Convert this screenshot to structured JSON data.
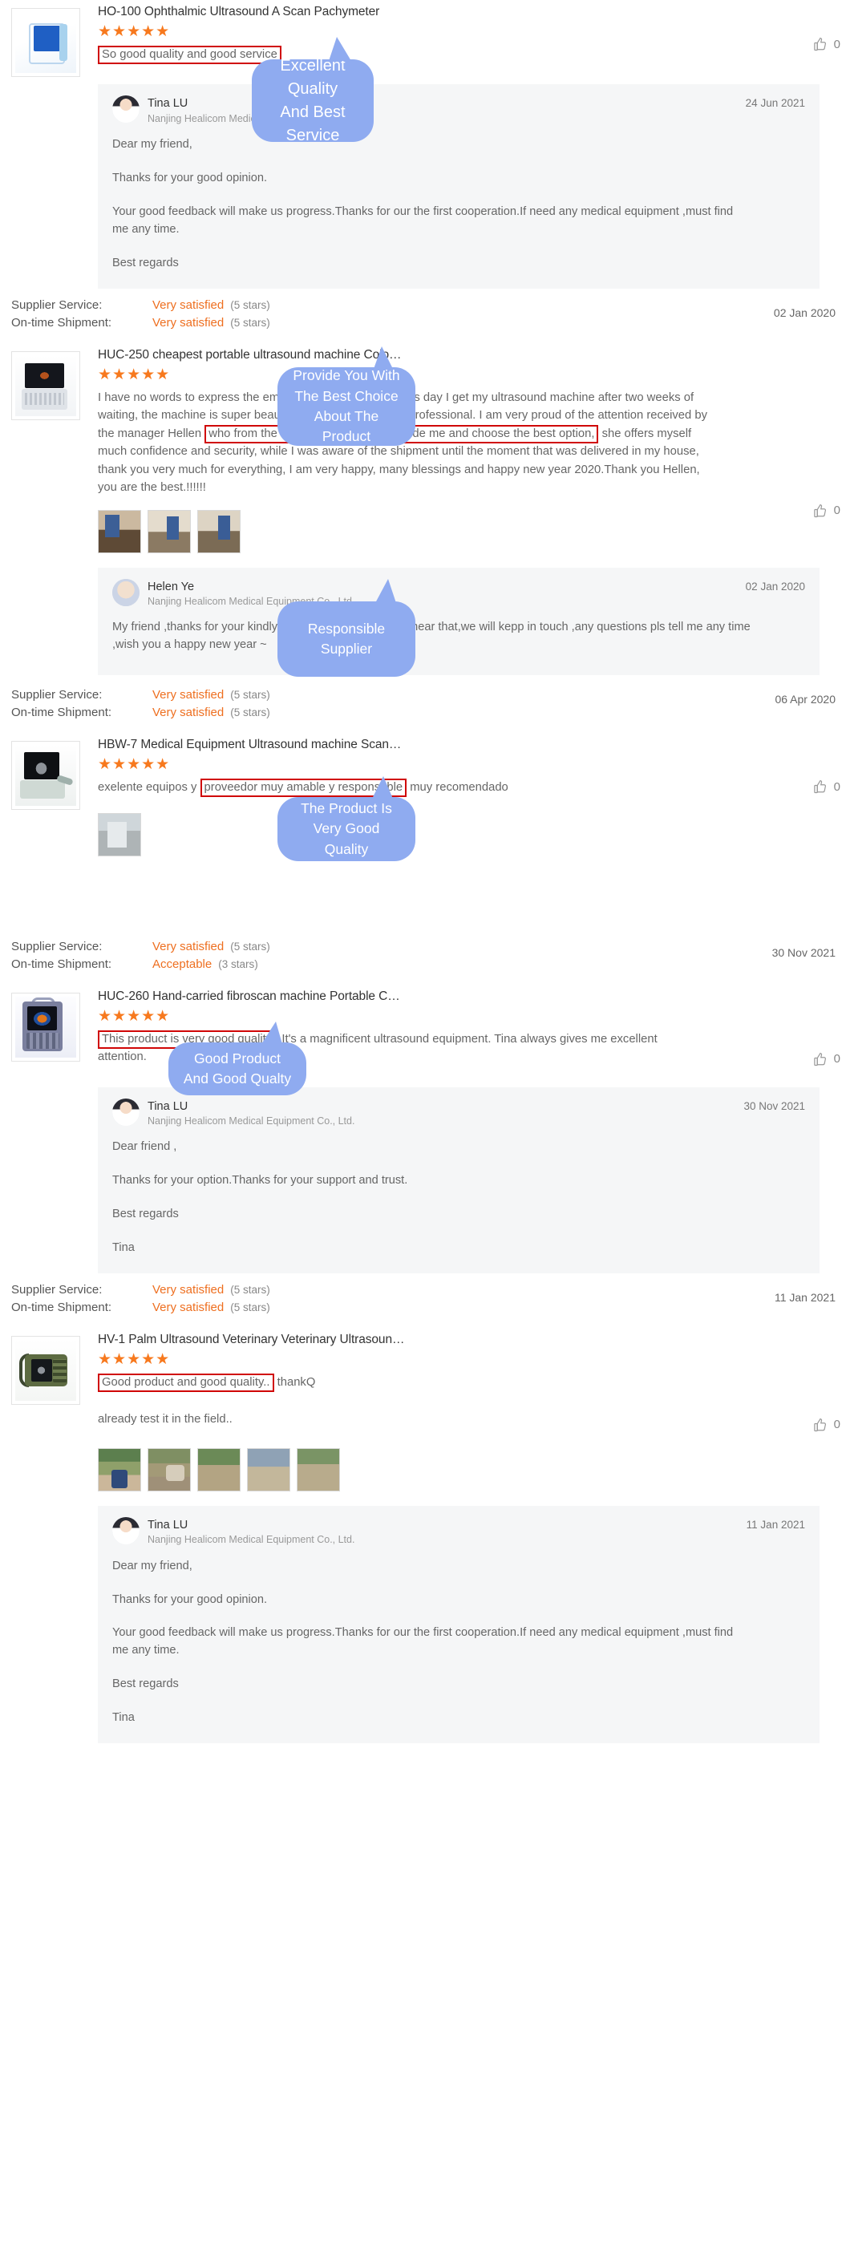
{
  "labels": {
    "supplier_service": "Supplier Service:",
    "on_time_shipment": "On-time Shipment:",
    "like_count": "0"
  },
  "reviews": [
    {
      "id": "ho-100",
      "product_title": "HO-100 Ophthalmic Ultrasound A Scan Pachymeter",
      "stars": "★★★★★",
      "review_text_highlight": "So good quality and good service",
      "like_count": "0",
      "reply": {
        "name": "Tina LU",
        "company": "Nanjing Healicom Medical Equipment Co., Ltd.",
        "date": "24 Jun 2021",
        "paragraphs": [
          "Dear my friend,",
          "Thanks for your good opinion.",
          "Your good feedback will make us progress.Thanks for our the first cooperation.If need any medical equipment ,must find me any time.",
          "Best regards"
        ]
      },
      "ratings": {
        "supplier_service_value": "Very satisfied",
        "supplier_service_stars": "(5 stars)",
        "on_time_value": "Very satisfied",
        "on_time_stars": "(5 stars)",
        "date": "02 Jan 2020"
      },
      "callout": "Excellent Quality\nAnd Best Service"
    },
    {
      "id": "huc-250",
      "product_title": "HUC-250 cheapest portable ultrasound machine Colo…",
      "stars": "★★★★★",
      "review_text_parts": [
        "I have no words to express the emotion that I have, in today's day I get my ultrasound machine after two weeks of waiting, the machine is super beautiful, all very secure and professional. I am very proud of the attention received by the manager Hellen",
        " who from the very first was there to guide me and choose the best option,",
        "she offers myself much confidence and security, while I was aware of the shipment until the moment that was delivered in my house, thank you very much for everything, I am very happy, many blessings and happy new year 2020.Thank you Hellen, you are the best.!!!!!!"
      ],
      "thumbnails": [
        "photo-box-1",
        "photo-box-2",
        "photo-box-3"
      ],
      "like_count": "0",
      "reply": {
        "name": "Helen Ye",
        "company": "Nanjing Healicom Medical Equipment Co., Ltd.",
        "date": "02 Jan 2020",
        "paragraphs": [
          "My friend ,thanks for your kindly comments,very happy to hear that,we will kepp in touch ,any questions pls tell me any time ,wish you a happy new year ~"
        ]
      },
      "ratings": {
        "supplier_service_value": "Very satisfied",
        "supplier_service_stars": "(5 stars)",
        "on_time_value": "Very satisfied",
        "on_time_stars": "(5 stars)",
        "date": "06 Apr 2020"
      },
      "callout": "Provide You With\nThe Best Choice\nAbout The Product"
    },
    {
      "id": "hbw-7",
      "product_title": "HBW-7 Medical Equipment Ultrasound machine Scan…",
      "stars": "★★★★★",
      "review_text_parts": [
        "exelente equipos y",
        "proveedor muy amable y responsable",
        "muy recomendado"
      ],
      "thumbnails": [
        "photo-room-1"
      ],
      "like_count": "0",
      "ratings": {
        "supplier_service_value": "Very satisfied",
        "supplier_service_stars": "(5 stars)",
        "on_time_value": "Acceptable",
        "on_time_stars": "(3 stars)",
        "date": "30 Nov 2021"
      },
      "callout": "Responsible\nSupplier"
    },
    {
      "id": "huc-260",
      "product_title": "HUC-260 Hand-carried fibroscan machine Portable C…",
      "stars": "★★★★★",
      "review_text_parts": [
        "This product is very good quality,",
        "It's a magnificent ultrasound equipment. Tina always gives me excellent attention."
      ],
      "like_count": "0",
      "reply": {
        "name": "Tina LU",
        "company": "Nanjing Healicom Medical Equipment Co., Ltd.",
        "date": "30 Nov 2021",
        "paragraphs": [
          "Dear friend ,",
          "Thanks for your option.Thanks for your support and trust.",
          "Best regards",
          "Tina"
        ]
      },
      "ratings": {
        "supplier_service_value": "Very satisfied",
        "supplier_service_stars": "(5 stars)",
        "on_time_value": "Very satisfied",
        "on_time_stars": "(5 stars)",
        "date": "11 Jan 2021"
      },
      "callout": "The Product Is\nVery Good Quality"
    },
    {
      "id": "hv-1",
      "product_title": "HV-1 Palm Ultrasound Veterinary Veterinary Ultrasoun…",
      "stars": "★★★★★",
      "review_text_parts": [
        "Good product and good quality..",
        " thankQ"
      ],
      "review_text_second_line": "already test it in the field..",
      "thumbnails": [
        "photo-field-1",
        "photo-field-2",
        "photo-field-3",
        "photo-field-4",
        "photo-field-5"
      ],
      "like_count": "0",
      "reply": {
        "name": "Tina LU",
        "company": "Nanjing Healicom Medical Equipment Co., Ltd.",
        "date": "11 Jan 2021",
        "paragraphs": [
          "Dear my friend,",
          "Thanks for your good opinion.",
          "Your good feedback will make us progress.Thanks for our the first cooperation.If need any medical equipment ,must find me any time.",
          "Best regards",
          "Tina"
        ]
      },
      "callout": "Good Product\nAnd Good Qualty"
    }
  ],
  "colors": {
    "callout_bg": "#8fabf0",
    "callout_text": "#ffffff",
    "star": "#f7791e",
    "rating_value": "#ee6f20",
    "highlight_border": "#d00606",
    "reply_bg": "#f5f6f7",
    "body_text": "#666666",
    "title_text": "#333333"
  }
}
